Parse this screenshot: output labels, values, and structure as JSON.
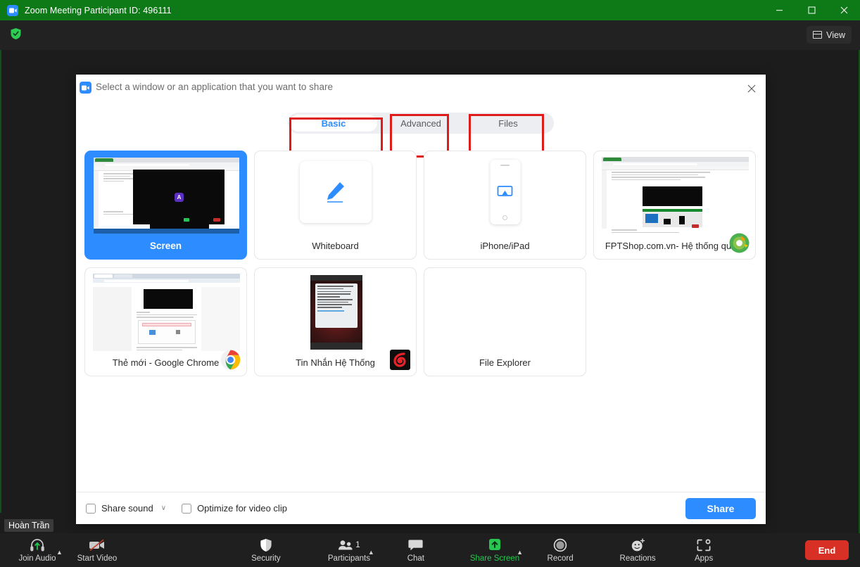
{
  "window": {
    "title": "Zoom Meeting Participant ID: 496111",
    "icon": "zoom-camera-icon",
    "titlebar_color": "#0d7a17",
    "controls": {
      "minimize": "—",
      "maximize": "☐",
      "close": "✕"
    }
  },
  "meeting_topbar": {
    "security_badge": "shield-check-icon",
    "view_button": {
      "label": "View",
      "icon": "grid-view-icon"
    }
  },
  "dialog": {
    "title": "Select a window or an application that you want to share",
    "icon": "zoom-camera-icon",
    "close": "✕",
    "tabs": [
      {
        "label": "Basic",
        "active": true,
        "annotated": true
      },
      {
        "label": "Advanced",
        "active": false,
        "annotated": true
      },
      {
        "label": "Files",
        "active": false,
        "annotated": true
      }
    ],
    "annotation_color": "#e01b1b",
    "accent_color": "#2d8cff",
    "tiles": [
      {
        "label": "Screen",
        "selected": true,
        "kind": "screen-preview",
        "app_icon": null
      },
      {
        "label": "Whiteboard",
        "selected": false,
        "kind": "whiteboard-pencil-icon",
        "app_icon": null
      },
      {
        "label": "iPhone/iPad",
        "selected": false,
        "kind": "phone-airplay-icon",
        "app_icon": null
      },
      {
        "label": "FPTShop.com.vn- Hệ thống quả...",
        "selected": false,
        "kind": "browser-window",
        "app_icon": "coccoc-icon"
      },
      {
        "label": "Thẻ mới - Google Chrome",
        "selected": false,
        "kind": "browser-window",
        "app_icon": "chrome-icon"
      },
      {
        "label": "Tin Nhắn Hệ Thống",
        "selected": false,
        "kind": "message-window",
        "app_icon": "garena-icon"
      },
      {
        "label": "File Explorer",
        "selected": false,
        "kind": "blank-window",
        "app_icon": null
      }
    ],
    "footer": {
      "share_sound": {
        "label": "Share sound",
        "checked": false,
        "has_dropdown": true,
        "chevron": "∨"
      },
      "optimize_video": {
        "label": "Optimize for video clip",
        "checked": false
      },
      "share_button": "Share"
    }
  },
  "toolbar": {
    "name_tag": "Hoàn Trần",
    "items": [
      {
        "label": "Join Audio",
        "icon": "headset-join-audio-icon",
        "caret": true,
        "active": false
      },
      {
        "label": "Start Video",
        "icon": "camera-off-icon",
        "caret": false,
        "active": false
      },
      {
        "label": "Security",
        "icon": "shield-icon",
        "caret": false,
        "active": false
      },
      {
        "label": "Participants",
        "icon": "participants-icon",
        "caret": true,
        "active": false,
        "count": "1"
      },
      {
        "label": "Chat",
        "icon": "chat-bubble-icon",
        "caret": false,
        "active": false
      },
      {
        "label": "Share Screen",
        "icon": "share-screen-up-arrow-icon",
        "caret": true,
        "active": true
      },
      {
        "label": "Record",
        "icon": "record-circle-icon",
        "caret": false,
        "active": false
      },
      {
        "label": "Reactions",
        "icon": "smiley-plus-icon",
        "caret": false,
        "active": false
      },
      {
        "label": "Apps",
        "icon": "apps-bracket-icon",
        "caret": false,
        "active": false
      }
    ],
    "end_button": {
      "label": "End",
      "color": "#d93025"
    }
  }
}
